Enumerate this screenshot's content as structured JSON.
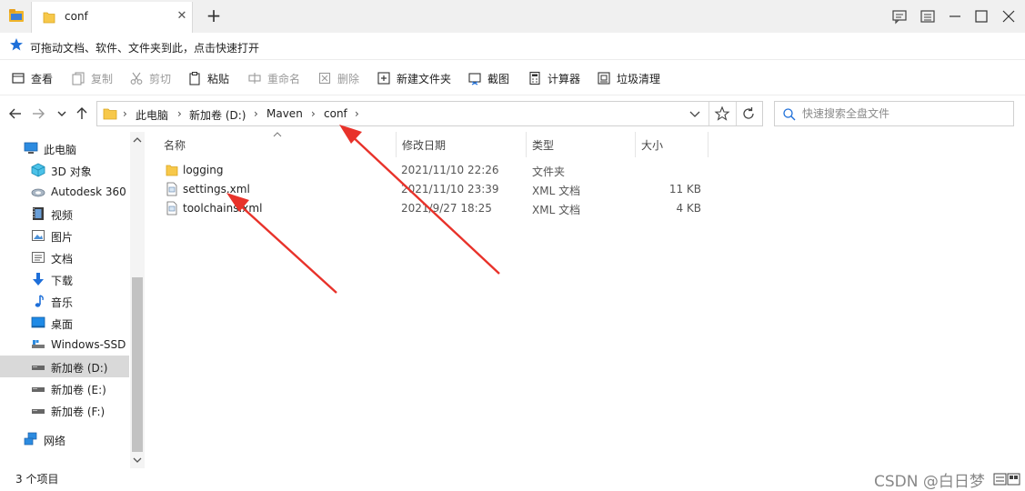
{
  "window": {
    "tab_title": "conf",
    "tab_close_glyph": "✕",
    "new_tab_glyph": "+",
    "controls": [
      "feedback-icon",
      "settings-icon",
      "minimize-icon",
      "maximize-icon",
      "close-icon"
    ]
  },
  "hint": {
    "text": "可拖动文档、软件、文件夹到此，点击快速打开",
    "icon": "star-icon",
    "icon_color": "#1e6fd9"
  },
  "toolbar": {
    "view": "查看",
    "copy": "复制",
    "cut": "剪切",
    "paste": "粘贴",
    "rename": "重命名",
    "delete": "删除",
    "new_folder": "新建文件夹",
    "screenshot": "截图",
    "calculator": "计算器",
    "cleanup": "垃圾清理"
  },
  "address": {
    "crumbs": [
      "此电脑",
      "新加卷 (D:)",
      "Maven",
      "conf"
    ],
    "separator": "›"
  },
  "search": {
    "placeholder": "快速搜索全盘文件",
    "value": ""
  },
  "sidebar": {
    "items": [
      {
        "label": "此电脑",
        "icon": "computer-icon"
      },
      {
        "label": "3D 对象",
        "icon": "cube-icon"
      },
      {
        "label": "Autodesk 360",
        "icon": "cloud-icon"
      },
      {
        "label": "视频",
        "icon": "video-icon"
      },
      {
        "label": "图片",
        "icon": "picture-icon"
      },
      {
        "label": "文档",
        "icon": "document-icon"
      },
      {
        "label": "下载",
        "icon": "download-icon"
      },
      {
        "label": "音乐",
        "icon": "music-icon"
      },
      {
        "label": "桌面",
        "icon": "desktop-icon"
      },
      {
        "label": "Windows-SSD",
        "icon": "drive-icon"
      },
      {
        "label": "新加卷 (D:)",
        "icon": "drive-icon",
        "selected": true
      },
      {
        "label": "新加卷 (E:)",
        "icon": "drive-icon"
      },
      {
        "label": "新加卷 (F:)",
        "icon": "drive-icon"
      },
      {
        "label": "网络",
        "icon": "network-icon"
      }
    ]
  },
  "columns": {
    "name": "名称",
    "modified": "修改日期",
    "type": "类型",
    "size": "大小"
  },
  "files": [
    {
      "name": "logging",
      "modified": "2021/11/10 22:26",
      "type": "文件夹",
      "size": "",
      "icon": "folder-icon"
    },
    {
      "name": "settings.xml",
      "modified": "2021/11/10 23:39",
      "type": "XML 文档",
      "size": "11 KB",
      "icon": "xml-file-icon"
    },
    {
      "name": "toolchains.xml",
      "modified": "2021/9/27 18:25",
      "type": "XML 文档",
      "size": "4 KB",
      "icon": "xml-file-icon"
    }
  ],
  "status": {
    "count_text": "3 个项目",
    "watermark": "CSDN @白日梦"
  },
  "colors": {
    "folder": "#f7c84a",
    "accent": "#1e6fd9",
    "annotation": "#e8322a",
    "selection": "#d9d9d9"
  }
}
